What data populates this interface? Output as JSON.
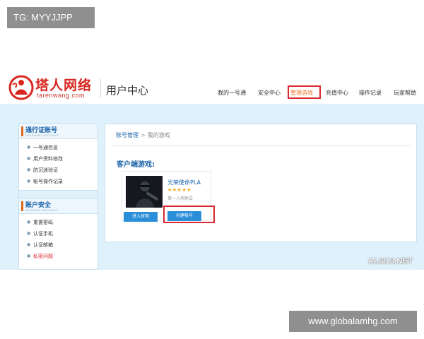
{
  "overlay": {
    "tag_top": "TG: MYYJJPP",
    "tag_bottom": "www.globalamhg.com"
  },
  "header": {
    "logo_cn": "塔人网络",
    "logo_en": "tarenwang.com",
    "title": "用户中心",
    "nav": [
      {
        "label": "我的一号通"
      },
      {
        "label": "安全中心"
      },
      {
        "label": "管理游戏",
        "active": true
      },
      {
        "label": "充值中心"
      },
      {
        "label": "操作记录"
      },
      {
        "label": "玩家帮助"
      }
    ]
  },
  "sidebar": {
    "groups": [
      {
        "title": "通行证账号",
        "subtitle": "PASSPORT ACCOUNT",
        "items": [
          {
            "label": "一号通信息"
          },
          {
            "label": "用户资料修改"
          },
          {
            "label": "防沉迷验证"
          },
          {
            "label": "帐号操作记录"
          }
        ]
      },
      {
        "title": "账户安全",
        "subtitle": "ACCOUNT SECURITY",
        "items": [
          {
            "label": "重置密码"
          },
          {
            "label": "认证手机"
          },
          {
            "label": "认证邮箱"
          },
          {
            "label": "私密问题",
            "warn": true
          }
        ]
      }
    ]
  },
  "main": {
    "breadcrumb": {
      "root": "账号管理",
      "separator": ">",
      "current": "我的游戏"
    },
    "section_title": "客户端游戏:",
    "game": {
      "name": "光荣使命PLA",
      "stars": "★★★★★",
      "genre": "第一人称射击",
      "btn_official": "进入官网",
      "btn_create": "创建帐号"
    }
  },
  "watermark": "ALI213.NET",
  "colors": {
    "brand_red": "#d8261f",
    "link_blue": "#1a63a8",
    "button_blue": "#2a8fd8",
    "highlight_box": "#d9282f",
    "band_bg": "#dff1fb"
  }
}
